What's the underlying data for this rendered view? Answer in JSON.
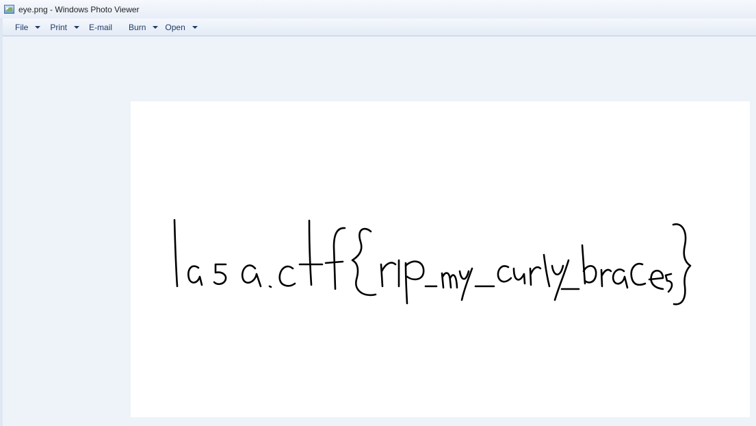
{
  "window": {
    "title": "eye.png - Windows Photo Viewer"
  },
  "menu": {
    "file": "File",
    "print": "Print",
    "email": "E-mail",
    "burn": "Burn",
    "open": "Open"
  },
  "photo": {
    "handwritten_text": "lasactf{rip_my_curly_braces}",
    "ink_color": "#000000",
    "background_color": "#ffffff"
  }
}
